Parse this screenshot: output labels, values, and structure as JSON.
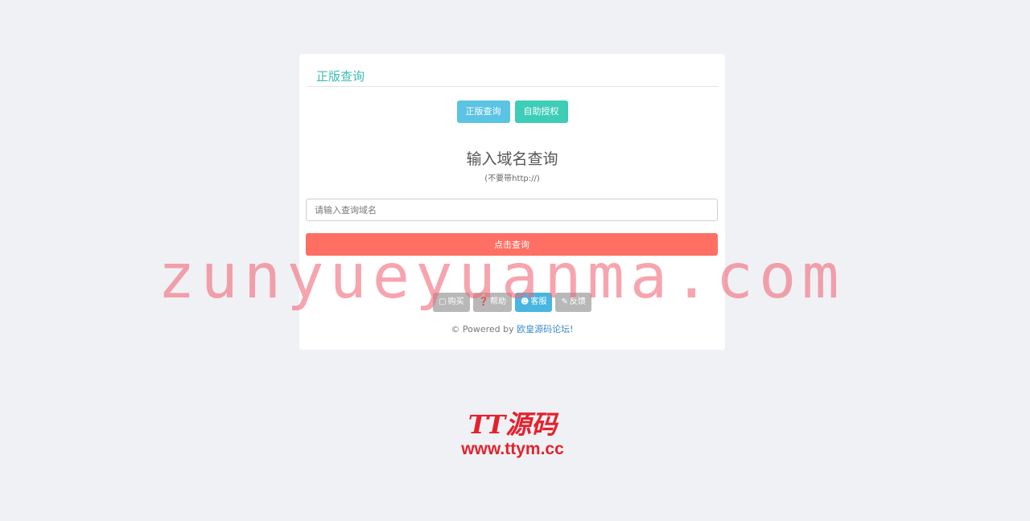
{
  "card": {
    "title": "正版查询",
    "tabs": {
      "query_label": "正版查询",
      "auth_label": "自助授权"
    },
    "heading": "输入域名查询",
    "subheading": "(不要带http://)",
    "input": {
      "placeholder": "请输入查询域名",
      "value": ""
    },
    "submit_label": "点击查询",
    "footer_buttons": {
      "buy": {
        "icon": "cart-icon",
        "label": "购买",
        "color": "#b8b8b8"
      },
      "help": {
        "icon": "help-icon",
        "label": "帮助",
        "color": "#b8b8b8"
      },
      "service": {
        "icon": "user-icon",
        "label": "客服",
        "color": "#48b6e0"
      },
      "feedback": {
        "icon": "pencil-icon",
        "label": "反馈",
        "color": "#b8b8b8"
      }
    },
    "powered": {
      "prefix": "© Powered by ",
      "link": "欧皇源码论坛!"
    }
  },
  "watermark": "zunyueyuanma.com",
  "brand": {
    "name": "TT源码",
    "url": "www.ttym.cc"
  },
  "colors": {
    "background": "#f0f1f5",
    "title_teal": "#3cbcb0",
    "tab_query": "#5bc3e3",
    "tab_auth": "#3ecdb6",
    "submit": "#ff6f63",
    "brand_red": "#e3222d"
  }
}
